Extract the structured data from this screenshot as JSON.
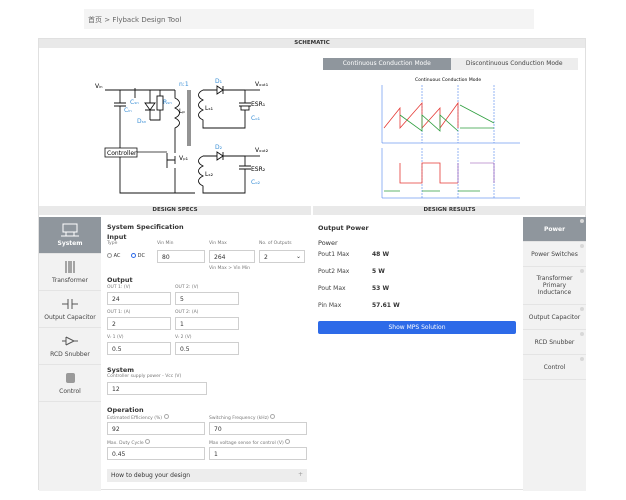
{
  "breadcrumb": {
    "home": "首页",
    "sep": ">",
    "current": "Flyback Design Tool"
  },
  "schematic": {
    "title": "SCHEMATIC",
    "tabs": [
      "Continuous Conduction Mode",
      "Discontinuous Conduction Mode"
    ],
    "circuit_labels": {
      "vin": "Vᵢₙ",
      "cin": "Cᵢₙ",
      "rsn": "Rₛₙ",
      "csn": "Cₛₙ",
      "dsn": "Dₛₙ",
      "ratio": "n:1",
      "d1": "D₁",
      "d2": "D₂",
      "lp": "Lₚ",
      "ls1": "Lₛ₁",
      "ls2": "Lₛ₂",
      "vout1": "Vₒᵤₜ₁",
      "vout2": "Vₒᵤₜ₂",
      "esr1": "ESR₁",
      "esr2": "ESR₂",
      "co1": "Cₒ₁",
      "co2": "Cₒ₂",
      "controller": "Controller",
      "q1": "Vₚ₁"
    },
    "wave_title": "Continuous Conduction Mode"
  },
  "design_specs": {
    "title": "DESIGN SPECS",
    "sidebar": [
      "System",
      "Transformer",
      "Output Capacitor",
      "RCD Snubber",
      "Control"
    ],
    "spec_title": "System Specification",
    "input": {
      "heading": "Input",
      "type_label": "Type",
      "ac": "AC",
      "dc": "DC",
      "vin_min_label": "Vin Min",
      "vin_min": "80",
      "vin_max_label": "Vin Max",
      "vin_max": "264",
      "outputs_label": "No. of Outputs",
      "outputs": "2",
      "hint": "Vin Max > Vin Min"
    },
    "output": {
      "heading": "Output",
      "out1_v_label": "OUT 1: (V)",
      "out1_v": "24",
      "out2_v_label": "OUT 2: (V)",
      "out2_v": "5",
      "out1_a_label": "OUT 1: (A)",
      "out1_a": "2",
      "out2_a_label": "OUT 2: (A)",
      "out2_a": "1",
      "vr1_label": "Vᵣ 1 (V)",
      "vr1": "0.5",
      "vr2_label": "Vᵣ 2 (V)",
      "vr2": "0.5"
    },
    "system": {
      "heading": "System",
      "supply_label": "Controller supply power - Vcc (V)",
      "supply": "12"
    },
    "operation": {
      "heading": "Operation",
      "eff_label": "Estimated Efficiency (%)",
      "eff": "92",
      "fsw_label": "Switching Frequency (kHz)",
      "fsw": "70",
      "duty_label": "Max. Duty Cycle",
      "duty": "0.45",
      "vsense_label": "Max voltage sense for control (V)",
      "vsense": "1"
    },
    "debug": "How to debug your design",
    "plus": "+"
  },
  "design_results": {
    "title": "DESIGN RESULTS",
    "section": "Output Power",
    "group": "Power",
    "rows": [
      {
        "label": "Pout1 Max",
        "value": "48 W"
      },
      {
        "label": "Pout2 Max",
        "value": "5 W"
      },
      {
        "label": "Pout Max",
        "value": "53 W"
      },
      {
        "label": "Pin Max",
        "value": "57.61 W"
      }
    ],
    "button": "Show MPS Solution",
    "sidebar": [
      "Power",
      "Power Switches",
      "Transformer Primary Inductance",
      "Output Capacitor",
      "RCD Snubber",
      "Control"
    ]
  },
  "colors": {
    "accent": "#2d6ae8",
    "label_blue": "#3a8fd6",
    "tab_active": "#8f969d",
    "wave_red": "#e53935",
    "wave_green": "#2e9e3e"
  }
}
